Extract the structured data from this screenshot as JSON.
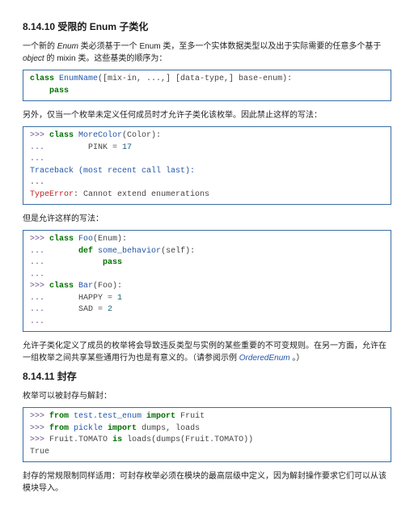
{
  "section1": {
    "heading": "8.14.10  受限的 Enum 子类化",
    "para1_a": "一个新的 ",
    "para1_enum": "Enum",
    "para1_b": " 类必须基于一个 Enum 类，至多一个实体数据类型以及出于实际需要的任意多个基于 ",
    "para1_object": "object",
    "para1_c": " 的 mixin 类。这些基类的顺序为：",
    "code1": {
      "l1_kw": "class",
      "l1_name": " EnumName",
      "l1_rest": "([mix-in, ...,] [data-type,] base-enum):",
      "l2": "    pass"
    },
    "para2": "另外，仅当一个枚举未定义任何成员时才允许子类化该枚举。因此禁止这样的写法：",
    "code2": {
      "p": ">>> ",
      "c": "... ",
      "l1_kw": "class",
      "l1_name": " MoreColor",
      "l1_rest": "(Color):",
      "l2_a": "        PINK ",
      "l2_eq": "=",
      "l2_num": " 17",
      "l3": "",
      "tb": "Traceback (most recent call last):",
      "dots": "...",
      "err_a": "TypeError",
      "err_b": ": Cannot extend enumerations"
    },
    "para3": "但是允许这样的写法：",
    "code3": {
      "p": ">>> ",
      "c": "... ",
      "l1_kw": "class",
      "l1_name": " Foo",
      "l1_rest": "(Enum):",
      "l2_kw": "def",
      "l2_name": " some_behavior",
      "l2_rest": "(self):",
      "l3_kw": "pass",
      "l4": "",
      "l5_kw": "class",
      "l5_name": " Bar",
      "l5_rest": "(Foo):",
      "l6_a": "      HAPPY ",
      "l6_eq": "=",
      "l6_num": " 1",
      "l7_a": "      SAD ",
      "l7_eq": "=",
      "l7_num": " 2",
      "l8": ""
    },
    "para4_a": "允许子类化定义了成员的枚举将会导致违反类型与实例的某些重要的不可变规则。在另一方面，允许在一组枚举之间共享某些通用行为也是有意义的。（请参阅示例 ",
    "para4_link": "OrderedEnum",
    "para4_b": " 。）"
  },
  "section2": {
    "heading": "8.14.11  封存",
    "para1": "枚举可以被封存与解封：",
    "code1": {
      "p": ">>> ",
      "l1_kw": "from",
      "l1_mod": " test.test_enum ",
      "l1_kw2": "import",
      "l1_rest": " Fruit",
      "l2_kw": "from",
      "l2_mod": " pickle ",
      "l2_kw2": "import",
      "l2_rest": " dumps, loads",
      "l3_a": "Fruit",
      "l3_b": ".",
      "l3_c": "TOMATO ",
      "l3_kw": "is",
      "l3_d": " loads(dumps(Fruit",
      "l3_e": ".",
      "l3_f": "TOMATO))",
      "l4": "True"
    },
    "para2": "封存的常规限制同样适用：可封存枚举必须在模块的最高层级中定义，因为解封操作要求它们可以从该模块导入。"
  }
}
